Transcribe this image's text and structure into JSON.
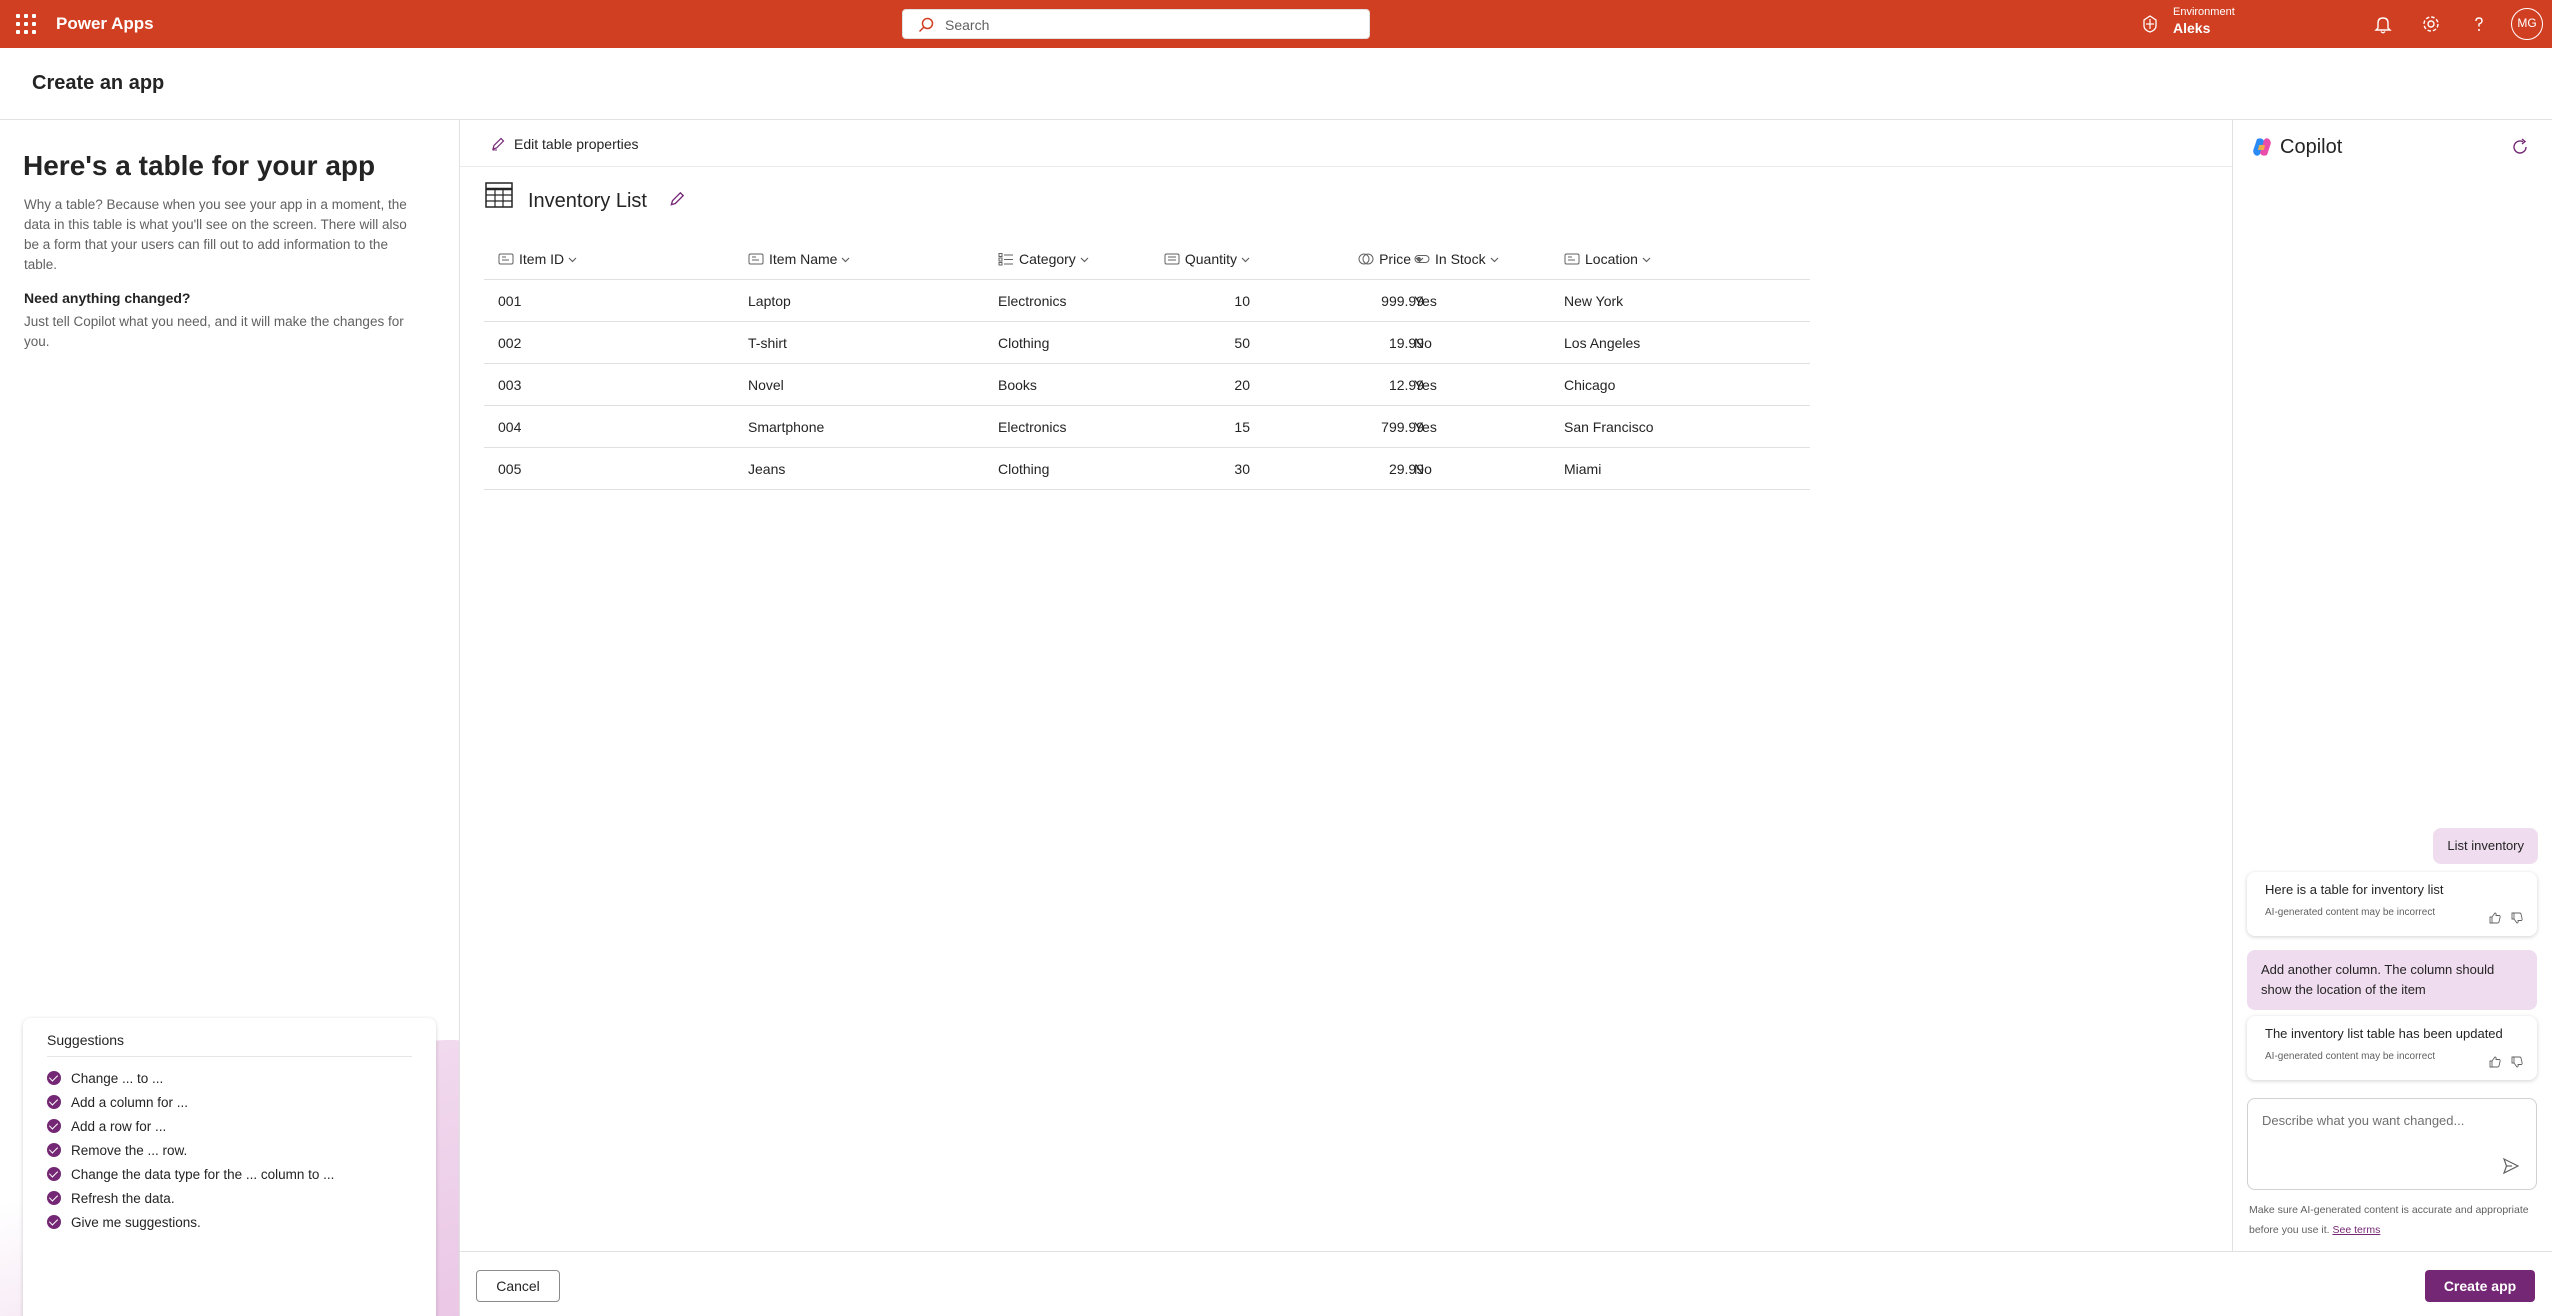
{
  "topbar": {
    "app_name": "Power Apps",
    "search_placeholder": "Search",
    "env_label": "Environment",
    "env_name": "Aleks",
    "avatar_initials": "MG"
  },
  "page": {
    "title": "Create an app"
  },
  "left": {
    "heading": "Here's a table for your app",
    "why_text": "Why a table? Because when you see your app in a moment, the data in this table is what you'll see on the screen. There will also be a form that your users can fill out to add information to the table.",
    "need_heading": "Need anything changed?",
    "need_text": "Just tell Copilot what you need, and it will make the changes for you.",
    "suggestions": {
      "title": "Suggestions",
      "items": [
        "Change ... to ...",
        "Add a column for ...",
        "Add a row for ...",
        "Remove the ... row.",
        "Change the data type for the ... column to ...",
        "Refresh the data.",
        "Give me suggestions."
      ]
    }
  },
  "center": {
    "edit_props_label": "Edit table properties",
    "table_title": "Inventory List",
    "columns": [
      "Item ID",
      "Item Name",
      "Category",
      "Quantity",
      "Price",
      "In Stock",
      "Location"
    ],
    "column_icons": [
      "text-field-icon",
      "text-field-icon",
      "choice-list-icon",
      "number-field-icon",
      "currency-icon",
      "toggle-icon",
      "text-field-icon"
    ],
    "rows": [
      [
        "001",
        "Laptop",
        "Electronics",
        "10",
        "999.99",
        "Yes",
        "New York"
      ],
      [
        "002",
        "T-shirt",
        "Clothing",
        "50",
        "19.99",
        "No",
        "Los Angeles"
      ],
      [
        "003",
        "Novel",
        "Books",
        "20",
        "12.99",
        "Yes",
        "Chicago"
      ],
      [
        "004",
        "Smartphone",
        "Electronics",
        "15",
        "799.99",
        "Yes",
        "San Francisco"
      ],
      [
        "005",
        "Jeans",
        "Clothing",
        "30",
        "29.99",
        "No",
        "Miami"
      ]
    ]
  },
  "copilot": {
    "title": "Copilot",
    "messages": [
      {
        "role": "user",
        "text": "List inventory"
      },
      {
        "role": "ai",
        "text": "Here is a table for inventory list",
        "disclaimer": "AI-generated content may be incorrect"
      },
      {
        "role": "user",
        "text": "Add another column. The column should show the location of the item"
      },
      {
        "role": "ai",
        "text": "The inventory list table has been updated",
        "disclaimer": "AI-generated content may be incorrect"
      }
    ],
    "input_placeholder": "Describe what you want changed...",
    "disclaimer": "Make sure AI-generated content is accurate and appropriate before you use it.",
    "see_terms": "See terms"
  },
  "footer": {
    "cancel_label": "Cancel",
    "create_label": "Create app"
  },
  "colors": {
    "topbar": "#d13f22",
    "accent": "#742774",
    "user_bubble": "#f0dcef"
  }
}
